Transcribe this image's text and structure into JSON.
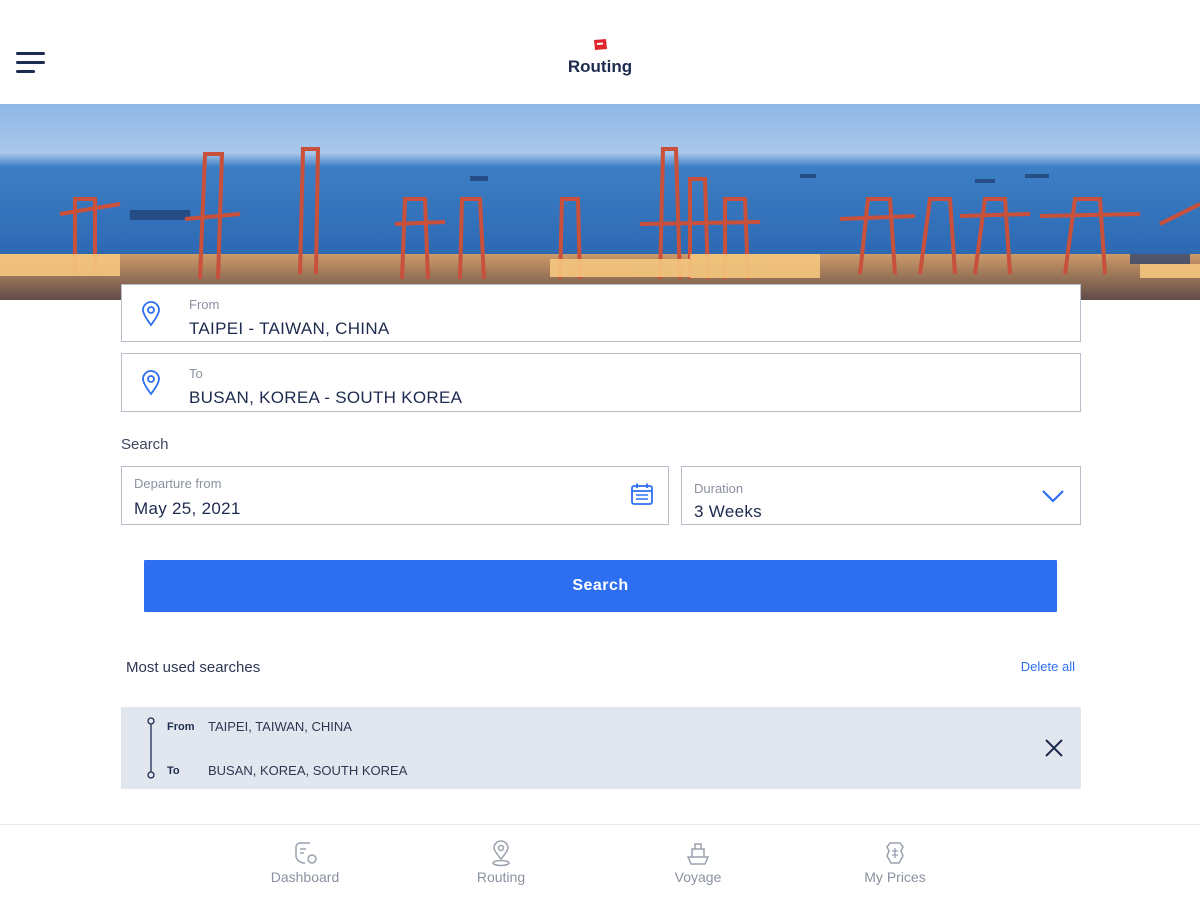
{
  "header": {
    "title": "Routing",
    "menu_icon": "hamburger-menu-icon",
    "logo_icon": "brand-logo-icon"
  },
  "colors": {
    "accent": "#2e6ff2",
    "text": "#1d2b4f",
    "muted": "#8a91a0",
    "recent_bg": "#e2e6ee",
    "logo": "#e0262b"
  },
  "form": {
    "from": {
      "label": "From",
      "value": "TAIPEI - TAIWAN, CHINA",
      "icon": "location-pin-icon"
    },
    "to": {
      "label": "To",
      "value": "BUSAN, KOREA - SOUTH KOREA",
      "icon": "location-pin-icon"
    },
    "search_section_label": "Search",
    "departure": {
      "label": "Departure from",
      "value": "May 25, 2021",
      "icon": "calendar-icon"
    },
    "duration": {
      "label": "Duration",
      "value": "3 Weeks",
      "icon": "chevron-down-icon"
    },
    "search_button": "Search"
  },
  "recent": {
    "title": "Most used searches",
    "delete_all": "Delete all",
    "items": [
      {
        "from_tag": "From",
        "from": "TAIPEI, TAIWAN, CHINA",
        "to_tag": "To",
        "to": "BUSAN, KOREA, SOUTH KOREA",
        "remove_icon": "close-icon"
      }
    ]
  },
  "nav": [
    {
      "label": "Dashboard",
      "icon": "dashboard-icon"
    },
    {
      "label": "Routing",
      "icon": "routing-pin-icon"
    },
    {
      "label": "Voyage",
      "icon": "voyage-ship-icon"
    },
    {
      "label": "My Prices",
      "icon": "prices-icon"
    }
  ]
}
